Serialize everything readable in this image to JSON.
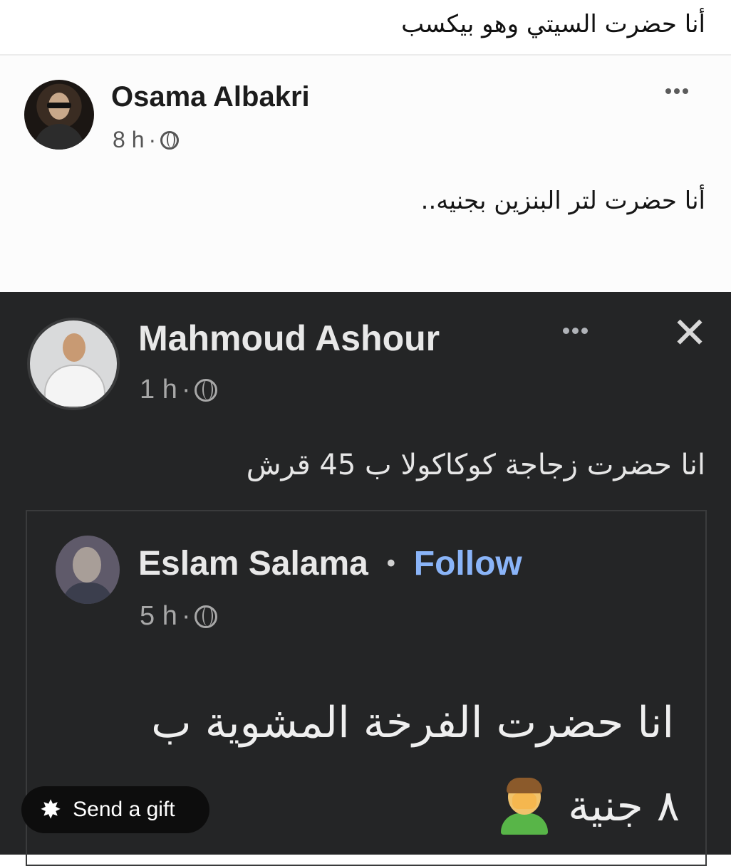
{
  "caption": "أنا حضرت السيتي وهو بيكسب",
  "posts": {
    "osama": {
      "name": "Osama Albakri",
      "time": "8 h",
      "dot": "·",
      "text": "أنا حضرت لتر البنزين بجنيه.."
    },
    "mahmoud": {
      "name": "Mahmoud Ashour",
      "time": "1 h",
      "dot": "·",
      "close": "✕",
      "text": "انا حضرت زجاجة كوكاكولا ب 45 قرش"
    },
    "eslam": {
      "name": "Eslam Salama",
      "separator": "•",
      "follow": "Follow",
      "time": "5 h",
      "dot": "·",
      "text_line1": "انا حضرت الفرخة المشوية ب",
      "text_line2": "٨ جنية"
    }
  },
  "gift_button": {
    "label": "Send a gift",
    "icon": "gift-icon"
  },
  "colors": {
    "dark_bg": "#242526",
    "follow_blue": "#8ab4f8",
    "white_bg": "#fcfcfc"
  }
}
